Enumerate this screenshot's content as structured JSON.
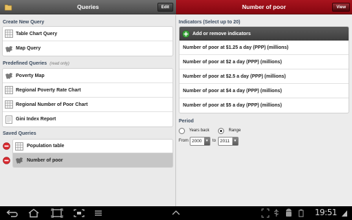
{
  "queries_bar": {
    "title": "Queries",
    "edit_label": "Edit"
  },
  "detail_bar": {
    "title": "Number of poor",
    "view_label": "View"
  },
  "sections": {
    "create_new": "Create New Query",
    "predefined": "Predefined Queries",
    "predefined_note": "(read only)",
    "saved": "Saved Queries"
  },
  "create_items": [
    {
      "label": "Table Chart Query",
      "icon": "table-chart-icon"
    },
    {
      "label": "Map Query",
      "icon": "map-icon"
    }
  ],
  "predefined_items": [
    {
      "label": "Poverty Map",
      "icon": "map-icon"
    },
    {
      "label": "Regional Poverty Rate Chart",
      "icon": "table-chart-icon"
    },
    {
      "label": "Regional Number of Poor Chart",
      "icon": "table-chart-icon"
    },
    {
      "label": "Gini Index Report",
      "icon": "report-icon"
    }
  ],
  "saved_items": [
    {
      "label": "Population table",
      "icon": "table-chart-icon",
      "selected": false
    },
    {
      "label": "Number of poor",
      "icon": "map-icon",
      "selected": true
    }
  ],
  "indicators": {
    "header": "Indicators (Select up to 20)",
    "add_label": "Add or remove indicators",
    "items": [
      "Number of poor at $1.25 a day (PPP) (millions)",
      "Number of poor at $2 a day (PPP) (millions)",
      "Number of poor at $2.5 a day (PPP) (millions)",
      "Number of poor at $4 a day (PPP) (millions)",
      "Number of poor at $5 a day (PPP) (millions)"
    ]
  },
  "period": {
    "header": "Period",
    "option_years_back": "Years back",
    "option_range": "Range",
    "selected_option": "Range",
    "from_label": "From",
    "to_label": "to",
    "from_value": "2000",
    "to_value": "2011"
  },
  "status": {
    "time": "19:51"
  },
  "colors": {
    "accent_red": "#9c0e17",
    "header_text": "#3a4a5e",
    "add_icon_green": "#3aa63a"
  }
}
